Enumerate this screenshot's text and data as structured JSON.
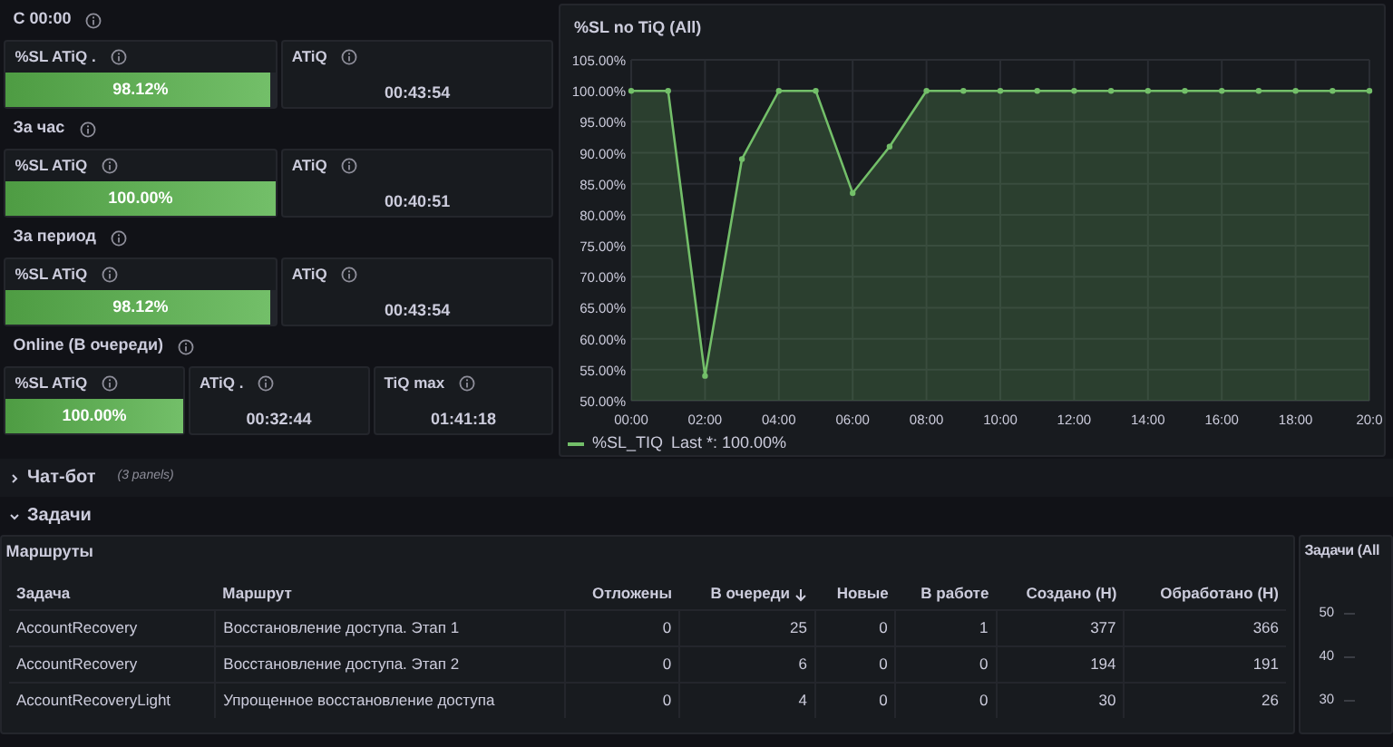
{
  "stat_sections": [
    {
      "title": "С 00:00",
      "panels": [
        {
          "kind": "gauge",
          "title": "%SL ATiQ .",
          "value": "98.12%",
          "level": 0.9812
        },
        {
          "kind": "value",
          "title": "ATiQ",
          "value": "00:43:54"
        }
      ]
    },
    {
      "title": "За час",
      "panels": [
        {
          "kind": "gauge",
          "title": "%SL ATiQ",
          "value": "100.00%",
          "level": 1
        },
        {
          "kind": "value",
          "title": "ATiQ",
          "value": "00:40:51"
        }
      ]
    },
    {
      "title": "За период",
      "panels": [
        {
          "kind": "gauge",
          "title": "%SL ATiQ",
          "value": "98.12%",
          "level": 0.9812
        },
        {
          "kind": "value",
          "title": "ATiQ",
          "value": "00:43:54"
        }
      ]
    },
    {
      "title": "Online (В очереди)",
      "panels": [
        {
          "kind": "gauge",
          "title": "%SL ATiQ",
          "value": "100.00%",
          "level": 1
        },
        {
          "kind": "value",
          "title": "ATiQ .",
          "value": "00:32:44"
        },
        {
          "kind": "value",
          "title": "TiQ max",
          "value": "01:41:18"
        }
      ]
    }
  ],
  "sl_chart": {
    "title": "%SL no TiQ (All)",
    "legend": "Last *: 100.00%",
    "chart_data": {
      "type": "area",
      "grid": true,
      "x": [
        0,
        1,
        2,
        3,
        4,
        5,
        6,
        7,
        8,
        9,
        10,
        11,
        12,
        13,
        14,
        15,
        16,
        17,
        18,
        19,
        20
      ],
      "xlim": [
        0,
        20
      ],
      "series": [
        {
          "name": "%SL_TIQ",
          "color": "#73bf69",
          "values": [
            100,
            100,
            54,
            89,
            100,
            100,
            83.5,
            91,
            100,
            100,
            100,
            100,
            100,
            100,
            100,
            100,
            100,
            100,
            100,
            100,
            100
          ]
        }
      ],
      "ylim": [
        50,
        105
      ],
      "yticks": [
        {
          "value": 50,
          "label": "50.00%"
        },
        {
          "value": 55,
          "label": "55.00%"
        },
        {
          "value": 60,
          "label": "60.00%"
        },
        {
          "value": 65,
          "label": "65.00%"
        },
        {
          "value": 70,
          "label": "70.00%"
        },
        {
          "value": 75,
          "label": "75.00%"
        },
        {
          "value": 80,
          "label": "80.00%"
        },
        {
          "value": 85,
          "label": "85.00%"
        },
        {
          "value": 90,
          "label": "90.00%"
        },
        {
          "value": 95,
          "label": "95.00%"
        },
        {
          "value": 100,
          "label": "100.00%"
        },
        {
          "value": 105,
          "label": "105.00%"
        }
      ],
      "xticks": [
        {
          "value": 0,
          "label": "00:00"
        },
        {
          "value": 2,
          "label": "02:00"
        },
        {
          "value": 4,
          "label": "04:00"
        },
        {
          "value": 6,
          "label": "06:00"
        },
        {
          "value": 8,
          "label": "08:00"
        },
        {
          "value": 10,
          "label": "10:00"
        },
        {
          "value": 12,
          "label": "12:00"
        },
        {
          "value": 14,
          "label": "14:00"
        },
        {
          "value": 16,
          "label": "16:00"
        },
        {
          "value": 18,
          "label": "18:00"
        },
        {
          "value": 20,
          "label": "20:0"
        }
      ]
    }
  },
  "rows": [
    {
      "title": "Чат-бот",
      "note": "(3 panels)",
      "expanded": false
    },
    {
      "title": "Задачи",
      "expanded": true
    }
  ],
  "routes_table": {
    "title": "Маршруты",
    "columns": [
      {
        "label": "Задача",
        "numeric": false,
        "sorted": false
      },
      {
        "label": "Маршрут",
        "numeric": false,
        "sorted": false
      },
      {
        "label": "Отложены",
        "numeric": true,
        "sorted": false
      },
      {
        "label": "В очереди",
        "numeric": true,
        "sorted": true
      },
      {
        "label": "Новые",
        "numeric": true,
        "sorted": false
      },
      {
        "label": "В работе",
        "numeric": true,
        "sorted": false
      },
      {
        "label": "Создано (Н)",
        "numeric": true,
        "sorted": false
      },
      {
        "label": "Обработано (Н)",
        "numeric": true,
        "sorted": false
      }
    ],
    "rows": [
      [
        "AccountRecovery",
        "Восстановление доступа. Этап 1",
        "0",
        "25",
        "0",
        "1",
        "377",
        "366"
      ],
      [
        "AccountRecovery",
        "Восстановление доступа. Этап 2",
        "0",
        "6",
        "0",
        "0",
        "194",
        "191"
      ],
      [
        "AccountRecoveryLight",
        "Упрощенное восстановление доступа",
        "0",
        "4",
        "0",
        "0",
        "30",
        "26"
      ]
    ]
  },
  "tasks_panel": {
    "title": "Задачи (All",
    "axis_labels": [
      "50",
      "40",
      "30"
    ]
  }
}
